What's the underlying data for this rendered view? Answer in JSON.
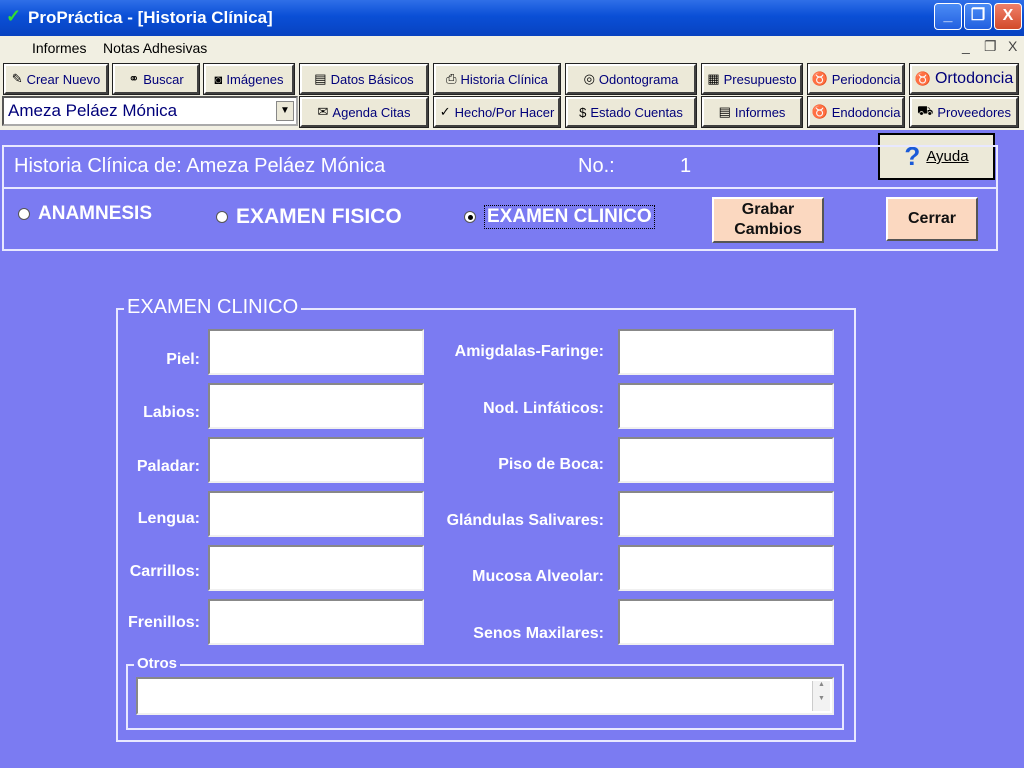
{
  "window": {
    "title": "ProPráctica - [Historia Clínica]",
    "minimize": "_",
    "maximize": "❐",
    "close": "X"
  },
  "menu": {
    "items": [
      "Informes",
      "Notas Adhesivas"
    ],
    "mdi_minimize": "_",
    "mdi_restore": "❐",
    "mdi_close": "X"
  },
  "toolbar": {
    "crear_nuevo": "Crear Nuevo",
    "buscar": "Buscar",
    "imagenes": "Imágenes",
    "datos_basicos": "Datos Básicos",
    "historia_clinica": "Historia Clínica",
    "odontograma": "Odontograma",
    "presupuesto": "Presupuesto",
    "periodoncia": "Periodoncia",
    "ortodoncia": "Ortodoncia",
    "agenda_citas": "Agenda Citas",
    "hecho_por_hacer": "Hecho/Por Hacer",
    "estado_cuentas": "Estado Cuentas",
    "informes": "Informes",
    "endodoncia": "Endodoncia",
    "proveedores": "Proveedores",
    "patient_selected": "Ameza Peláez Mónica"
  },
  "header": {
    "title": "Historia Clínica de: Ameza Peláez Mónica",
    "no_label": "No.:",
    "no_value": "1",
    "ayuda": "Ayuda"
  },
  "tabs": {
    "anamnesis": "ANAMNESIS",
    "examen_fisico": "EXAMEN FISICO",
    "examen_clinico": "EXAMEN CLINICO",
    "selected": "EXAMEN CLINICO"
  },
  "actions": {
    "grabar_line1": "Grabar",
    "grabar_line2": "Cambios",
    "cerrar": "Cerrar"
  },
  "form": {
    "legend": "EXAMEN CLINICO",
    "left_fields": [
      {
        "label": "Piel:",
        "value": ""
      },
      {
        "label": "Labios:",
        "value": ""
      },
      {
        "label": "Paladar:",
        "value": ""
      },
      {
        "label": "Lengua:",
        "value": ""
      },
      {
        "label": "Carrillos:",
        "value": ""
      },
      {
        "label": "Frenillos:",
        "value": ""
      }
    ],
    "right_fields": [
      {
        "label": "Amigdalas-Faringe:",
        "value": ""
      },
      {
        "label": "Nod. Linfáticos:",
        "value": ""
      },
      {
        "label": "Piso de Boca:",
        "value": ""
      },
      {
        "label": "Glándulas Salivares:",
        "value": ""
      },
      {
        "label": "Mucosa Alveolar:",
        "value": ""
      },
      {
        "label": "Senos Maxilares:",
        "value": ""
      }
    ],
    "otros_legend": "Otros",
    "otros_value": ""
  },
  "colors": {
    "background": "#7b7bf2",
    "button_accent": "#fbd8c0",
    "titlebar": "#0a4fd6"
  }
}
